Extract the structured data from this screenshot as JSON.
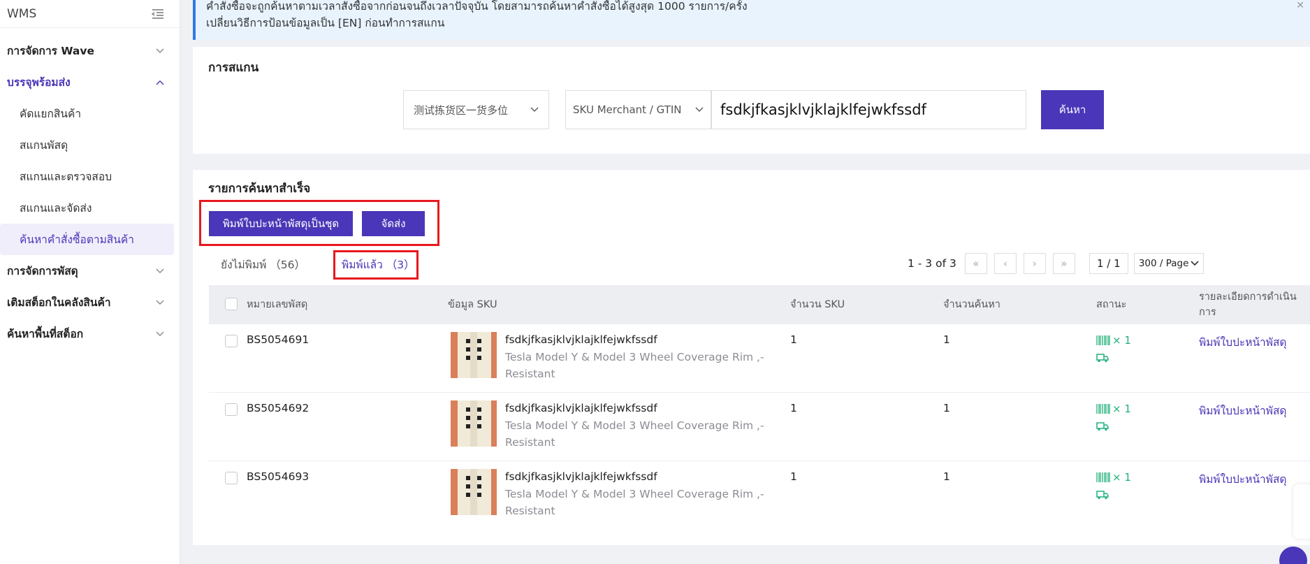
{
  "sidebar": {
    "title": "WMS",
    "items": [
      {
        "label": "การจัดการ Wave"
      },
      {
        "label": "บรรจุพร้อมส่ง"
      },
      {
        "label": "การจัดการพัสดุ"
      },
      {
        "label": "เติมสต็อกในคลังสินค้า"
      },
      {
        "label": "ค้นหาพื้นที่สต็อก"
      }
    ],
    "subitems": [
      {
        "label": "คัดแยกสินค้า"
      },
      {
        "label": "สแกนพัสดุ"
      },
      {
        "label": "สแกนและตรวจสอบ"
      },
      {
        "label": "สแกนและจัดส่ง"
      },
      {
        "label": "ค้นหาคำสั่งซื้อตามสินค้า"
      }
    ]
  },
  "notice": {
    "line1": "คำสั่งซื้อจะถูกค้นหาตามเวลาสั่งซื้อจากก่อนจนถึงเวลาปัจจุบัน โดยสามารถค้นหาคำสั่งซื้อได้สูงสุด 1000 รายการ/ครั้ง",
    "line2": "เปลี่ยนวิธีการป้อนข้อมูลเป็น [EN] ก่อนทำการสแกน"
  },
  "scan": {
    "title": "การสแกน",
    "zone_select": "测试拣货区一货多位",
    "type_select": "SKU Merchant / GTIN",
    "input_value": "fsdkjfkasjklvjklajklfejwkfssdf",
    "search_label": "ค้นหา"
  },
  "results": {
    "title": "รายการค้นหาสำเร็จ",
    "btn_print_batch": "พิมพ์ใบปะหน้าพัสดุเป็นชุด",
    "btn_ship": "จัดส่ง",
    "tab_unprinted": "ยังไม่พิมพ์ （56）",
    "tab_printed": "พิมพ์แล้ว （3）",
    "pager": {
      "range": "1 - 3 of 3",
      "page": "1 / 1",
      "size": "300 / Page"
    },
    "columns": {
      "parcel": "หมายเลขพัสดุ",
      "sku_info": "ข้อมูล SKU",
      "sku_count": "จำนวน SKU",
      "qty": "จำนวนค้นหา",
      "status": "สถานะ",
      "detail": "รายละเอียดการดำเนินการ"
    },
    "rows": [
      {
        "parcel": "BS5054691",
        "sku": "fsdkjfkasjklvjklajklfejwkfssdf",
        "desc": "Tesla Model Y & Model 3 Wheel Coverage Rim ,-Resistant",
        "sku_count": "1",
        "qty": "1",
        "barcode_count": "× 1",
        "action": "พิมพ์ใบปะหน้าพัสดุ"
      },
      {
        "parcel": "BS5054692",
        "sku": "fsdkjfkasjklvjklajklfejwkfssdf",
        "desc": "Tesla Model Y & Model 3 Wheel Coverage Rim ,-Resistant",
        "sku_count": "1",
        "qty": "1",
        "barcode_count": "× 1",
        "action": "พิมพ์ใบปะหน้าพัสดุ"
      },
      {
        "parcel": "BS5054693",
        "sku": "fsdkjfkasjklvjklajklfejwkfssdf",
        "desc": "Tesla Model Y & Model 3 Wheel Coverage Rim ,-Resistant",
        "sku_count": "1",
        "qty": "1",
        "barcode_count": "× 1",
        "action": "พิมพ์ใบปะหน้าพัสดุ"
      }
    ]
  },
  "colors": {
    "primary": "#4a36b8",
    "highlight": "#e8181e",
    "status": "#20b07a",
    "notice_bg": "#e8f3fe"
  }
}
